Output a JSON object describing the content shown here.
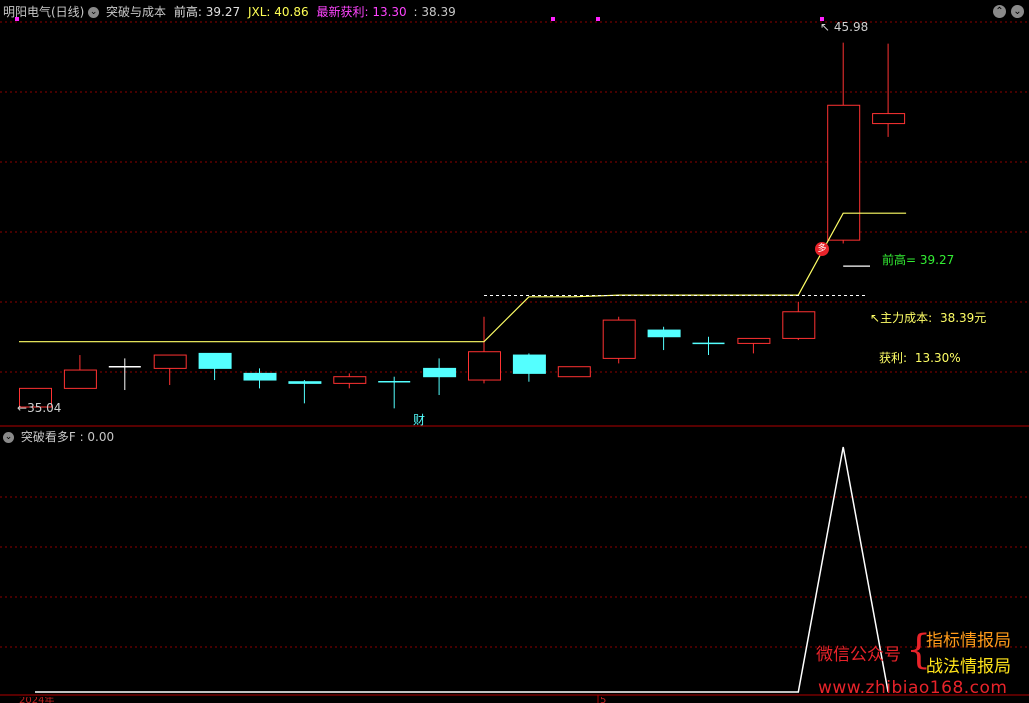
{
  "header": {
    "stock_name": "明阳电气(日线)",
    "indicator_name": "突破与成本",
    "qiangao_label": "前高:",
    "qiangao_value": "39.27",
    "jxl_label": "JXL:",
    "jxl_value": "40.86",
    "profit_label": "最新获利:",
    "profit_value": "13.30",
    "price_sep": ":",
    "price_value": "38.39"
  },
  "sub_header": {
    "indicator_name": "突破看多F",
    "value": ": 0.00"
  },
  "annotations": {
    "high_price": "45.98",
    "low_price": "35.04",
    "qiangao_line_label": "前高= 39.27",
    "cost_label": "主力成本:",
    "cost_value": "38.39元",
    "huoli_label": "获利:",
    "huoli_value": "13.30%",
    "cai_marker": "财",
    "duo_marker": "多"
  },
  "footer": {
    "year_label": "2024年",
    "month_label": "5"
  },
  "watermark": {
    "wechat": "微信公众号",
    "brace": "{",
    "name1": "指标情报局",
    "name2": "战法情报局",
    "url": "www.zhibiao168.com"
  },
  "colors": {
    "up": "#ff3232",
    "down": "#54ffff",
    "cost_line": "#ffff66",
    "grid": "#8b0000",
    "white": "#ffffff"
  },
  "chart_data": [
    {
      "type": "candlestick",
      "title": "明阳电气(日线)",
      "ylim": [
        34.5,
        46.6
      ],
      "candles": [
        {
          "o": 35.04,
          "h": 35.6,
          "l": 35.04,
          "c": 35.6,
          "dir": "up"
        },
        {
          "o": 35.6,
          "h": 36.6,
          "l": 35.6,
          "c": 36.15,
          "dir": "up"
        },
        {
          "o": 36.25,
          "h": 36.5,
          "l": 35.55,
          "c": 36.25,
          "dir": "flat"
        },
        {
          "o": 36.2,
          "h": 36.6,
          "l": 35.7,
          "c": 36.6,
          "dir": "up"
        },
        {
          "o": 36.65,
          "h": 36.65,
          "l": 35.85,
          "c": 36.2,
          "dir": "down"
        },
        {
          "o": 36.05,
          "h": 36.2,
          "l": 35.6,
          "c": 35.85,
          "dir": "down"
        },
        {
          "o": 35.8,
          "h": 35.85,
          "l": 35.15,
          "c": 35.75,
          "dir": "down"
        },
        {
          "o": 35.75,
          "h": 36.05,
          "l": 35.6,
          "c": 35.95,
          "dir": "up"
        },
        {
          "o": 35.8,
          "h": 35.95,
          "l": 35.0,
          "c": 35.8,
          "dir": "flat"
        },
        {
          "o": 36.2,
          "h": 36.5,
          "l": 35.4,
          "c": 35.95,
          "dir": "down"
        },
        {
          "o": 36.7,
          "h": 37.75,
          "l": 35.75,
          "c": 35.85,
          "dir": "up"
        },
        {
          "o": 36.6,
          "h": 36.65,
          "l": 35.8,
          "c": 36.05,
          "dir": "down"
        },
        {
          "o": 35.95,
          "h": 36.25,
          "l": 35.95,
          "c": 36.25,
          "dir": "up"
        },
        {
          "o": 36.5,
          "h": 37.75,
          "l": 36.35,
          "c": 37.65,
          "dir": "up"
        },
        {
          "o": 37.35,
          "h": 37.45,
          "l": 36.75,
          "c": 37.15,
          "dir": "down"
        },
        {
          "o": 36.95,
          "h": 37.15,
          "l": 36.6,
          "c": 36.95,
          "dir": "flat"
        },
        {
          "o": 36.95,
          "h": 37.05,
          "l": 36.65,
          "c": 37.1,
          "dir": "up"
        },
        {
          "o": 37.1,
          "h": 38.2,
          "l": 37.05,
          "c": 37.9,
          "dir": "up"
        },
        {
          "o": 40.05,
          "h": 45.98,
          "l": 39.95,
          "c": 44.1,
          "dir": "up"
        },
        {
          "o": 43.55,
          "h": 45.95,
          "l": 43.15,
          "c": 43.85,
          "dir": "up"
        }
      ],
      "cost_line": [
        37.0,
        37.0,
        37.0,
        37.0,
        37.0,
        37.0,
        37.0,
        37.0,
        37.0,
        37.0,
        37.0,
        38.35,
        38.35,
        38.4,
        38.4,
        38.4,
        38.4,
        38.4,
        40.86,
        40.86
      ],
      "qiangao": 39.27,
      "cost": 38.39
    },
    {
      "type": "line",
      "title": "突破看多F",
      "ylim": [
        0,
        1
      ],
      "values": [
        0,
        0,
        0,
        0,
        0,
        0,
        0,
        0,
        0,
        0,
        0,
        0,
        0,
        0,
        0,
        0,
        0,
        0,
        1,
        0
      ]
    }
  ]
}
